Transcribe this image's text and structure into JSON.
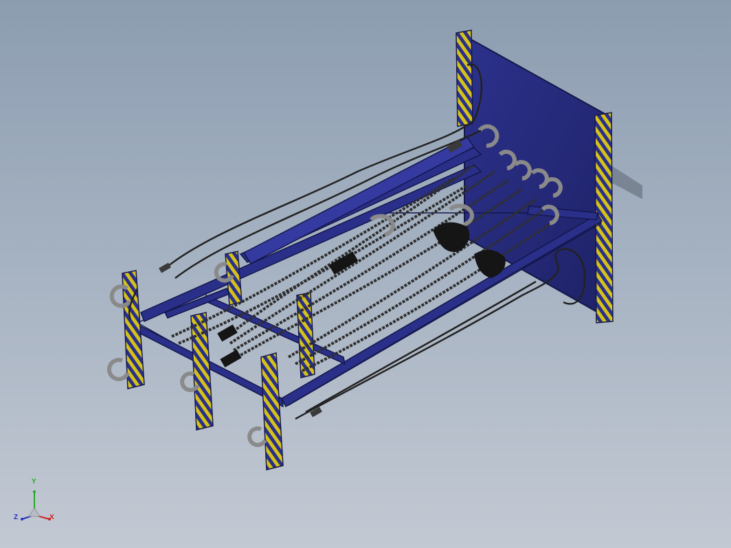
{
  "viewer": {
    "background_top": "#8c9db0",
    "background_bottom": "#c3c9d3",
    "model": "chain-hoist-storage-rack"
  },
  "colors": {
    "frame_blue": "#2a2f8a",
    "frame_blue_dark": "#1a1d5e",
    "panel_blue": "#262a78",
    "warning_yellow": "#d4c21a",
    "chain_dark": "#2b2b2b",
    "chain_light": "#6a6a6a",
    "hook_gray": "#8a8a8a",
    "cable_black": "#222222"
  },
  "triad": {
    "x_label": "X",
    "y_label": "Y",
    "z_label": "Z",
    "x_color": "#cc2222",
    "y_color": "#22aa22",
    "z_color": "#2233bb"
  }
}
